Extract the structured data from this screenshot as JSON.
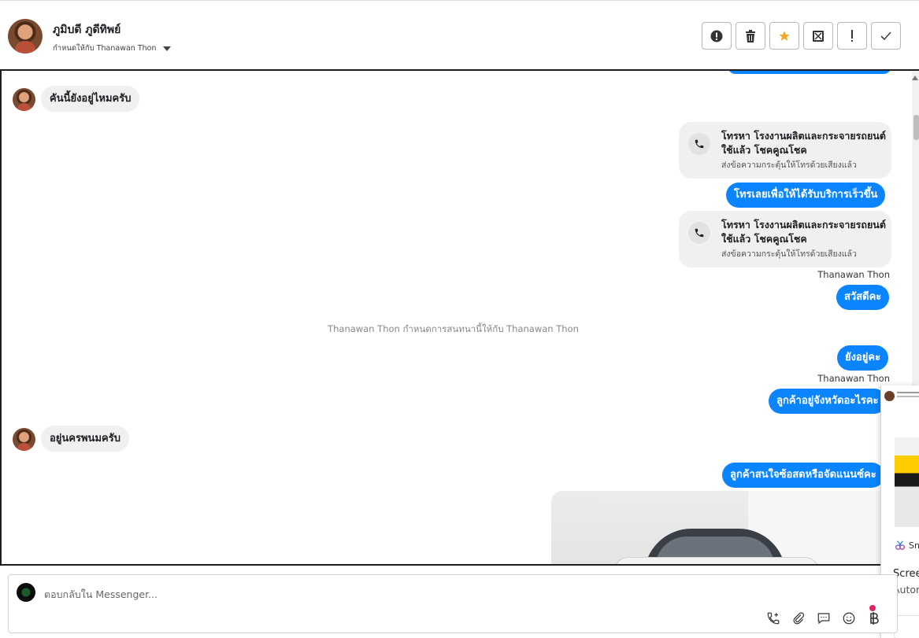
{
  "header": {
    "contact_name": "ภูมิบดี ภูดีทิพย์",
    "assigned_label": "กำหนดให้กับ Thanawan Thon"
  },
  "actions": [
    {
      "name": "spam",
      "icon": "exclamation-circle-icon"
    },
    {
      "name": "delete",
      "icon": "trash-icon"
    },
    {
      "name": "star",
      "icon": "star-icon",
      "color": "#f5a623"
    },
    {
      "name": "mark-unread",
      "icon": "envelope-x-icon"
    },
    {
      "name": "follow-up",
      "icon": "exclamation-icon"
    },
    {
      "name": "done",
      "icon": "check-icon"
    }
  ],
  "messages": {
    "in_1": "คันนี้ยังอยู่ไหมครับ",
    "call_card_1": {
      "title": "โทรหา โรงงานผลิตและกระจายรถยนต์ใช้แล้ว โชคคูณโชค",
      "subtitle": "ส่งข้อความกระตุ้นให้โทรด้วยเสียงแล้ว"
    },
    "out_1": "โทรเลยเพื่อให้ได้รับบริการเร็วขึ้น",
    "call_card_2": {
      "title": "โทรหา โรงงานผลิตและกระจายรถยนต์ใช้แล้ว โชคคูณโชค",
      "subtitle": "ส่งข้อความกระตุ้นให้โทรด้วยเสียงแล้ว"
    },
    "sender_1": "Thanawan Thon",
    "out_2": "สวัสดีคะ",
    "system_1": "Thanawan Thon กำหนดการสนทนานี้ให้กับ Thanawan Thon",
    "out_3": "ยังอยู่คะ",
    "sender_2": "Thanawan Thon",
    "out_4": "ลูกค้าอยู่จังหวัดอะไรคะ",
    "in_2": "อยู่นครพนมครับ",
    "out_5": "ลูกค้าสนใจซ้อสดหรือจัดแนนซ์คะ"
  },
  "popup": {
    "app_label": "Sn",
    "title": "Scree",
    "subtitle": "Auton"
  },
  "composer": {
    "placeholder": "ตอบกลับใน Messenger..."
  },
  "colors": {
    "accent": "#0a84ff",
    "bubble_in": "#f0f0f0",
    "star": "#f5a623"
  }
}
